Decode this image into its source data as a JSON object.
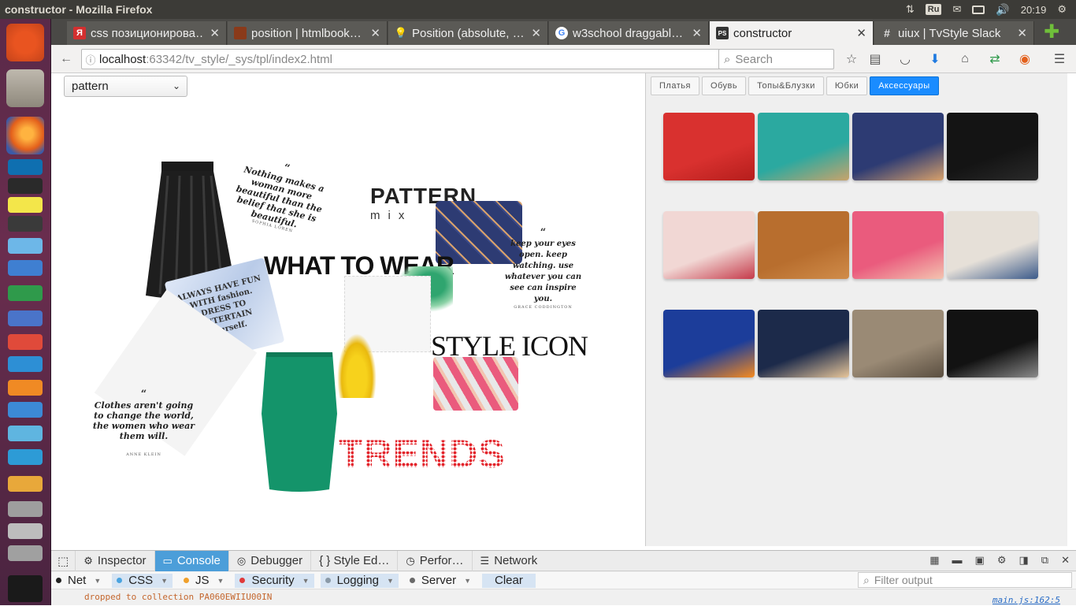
{
  "window_title": "constructor - Mozilla Firefox",
  "system": {
    "keyboard_layout": "Ru",
    "clock": "20:19"
  },
  "tabs": [
    {
      "label": "css позиционирова…",
      "favicon": "yandex-icon",
      "color": "#d32f2f",
      "glyph": "Я"
    },
    {
      "label": "position | htmlbook…",
      "favicon": "htmlbook-icon",
      "color": "#8a3a1a",
      "glyph": ""
    },
    {
      "label": "Position (absolute, …",
      "favicon": "lightbulb-icon",
      "color": "#f5c518",
      "glyph": "💡"
    },
    {
      "label": "w3school draggabl…",
      "favicon": "google-icon",
      "color": "#ffffff",
      "glyph": "G"
    },
    {
      "label": "constructor",
      "favicon": "pycharm-icon",
      "color": "#333333",
      "glyph": "PS"
    },
    {
      "label": "uiux | TvStyle Slack",
      "favicon": "slack-icon",
      "color": "#6b2d5b",
      "glyph": "#"
    }
  ],
  "navbar": {
    "url_host": "localhost",
    "url_rest": ":63342/tv_style/_sys/tpl/index2.html",
    "search_placeholder": "Search"
  },
  "page": {
    "select_value": "pattern",
    "collage": {
      "quote1_text": "Nothing makes a woman more beautiful than the belief that she is beautiful.",
      "quote1_author": "SOPHIA LOREN",
      "quote2_text": "keep your eyes open. keep watching. use whatever you can see can inspire you.",
      "quote2_author": "GRACE CODDINGTON",
      "quote3_text": "Clothes aren't going to change the world, the women who wear them will.",
      "quote3_author": "ANNE KLEIN",
      "quote4_text": "ALWAYS HAVE FUN WITH fashion. DRESS TO ENTERTAIN yourself.",
      "pattern_word": "PATTERN",
      "mix_word": "mix",
      "what_to_wear": "WHAT TO WEAR",
      "style_icon": "STYLE ICON",
      "trends": "TRENDS"
    }
  },
  "right_panel": {
    "category_tabs": [
      "Платья",
      "Обувь",
      "Топы&Блузки",
      "Юбки",
      "Аксессуары"
    ],
    "active_tab": "Аксессуары",
    "products": [
      {
        "name": "red-clutch",
        "colors": [
          "#d9312f",
          "#b51e1c"
        ]
      },
      {
        "name": "teal-tassel-clutch",
        "colors": [
          "#2ba9a0",
          "#c9a36b"
        ]
      },
      {
        "name": "navy-print-clutch",
        "colors": [
          "#2d3b73",
          "#d8a16b"
        ]
      },
      {
        "name": "black-clutch",
        "colors": [
          "#141414",
          "#2a2a2a"
        ]
      },
      {
        "name": "floral-clutch",
        "colors": [
          "#f1d7d4",
          "#c53a4a"
        ]
      },
      {
        "name": "studded-tan-clutch",
        "colors": [
          "#b86e2e",
          "#d08c4a"
        ]
      },
      {
        "name": "pink-triangle-clutch",
        "colors": [
          "#ea5b7d",
          "#f3c4b0"
        ]
      },
      {
        "name": "paisley-clutch",
        "colors": [
          "#e6e0d8",
          "#3b5a8a"
        ]
      },
      {
        "name": "orange-slice-clutch",
        "colors": [
          "#1c3d9a",
          "#f58a1f"
        ]
      },
      {
        "name": "tribal-clutch",
        "colors": [
          "#1c2a4a",
          "#e7c69a"
        ]
      },
      {
        "name": "snakeskin-clutch",
        "colors": [
          "#9a8a75",
          "#5a4e40"
        ]
      },
      {
        "name": "studded-black-clutch",
        "colors": [
          "#121212",
          "#8a8a8a"
        ]
      }
    ]
  },
  "devtools": {
    "tabs": [
      {
        "label": "Inspector",
        "icon": "wrench-icon",
        "glyph": "🔧"
      },
      {
        "label": "Console",
        "icon": "console-icon",
        "glyph": "▭"
      },
      {
        "label": "Debugger",
        "icon": "debugger-icon",
        "glyph": "⏸"
      },
      {
        "label": "{ } Style Ed…",
        "icon": "style-editor-icon",
        "glyph": ""
      },
      {
        "label": "Perfor…",
        "icon": "performance-icon",
        "glyph": "◷"
      },
      {
        "label": "Network",
        "icon": "network-icon",
        "glyph": "☰"
      }
    ],
    "active_tab": "Console",
    "filters": [
      {
        "label": "Net",
        "color": "#222222",
        "on": false
      },
      {
        "label": "CSS",
        "color": "#4aa3df",
        "on": true
      },
      {
        "label": "JS",
        "color": "#f0a02b",
        "on": false
      },
      {
        "label": "Security",
        "color": "#e03a3a",
        "on": true
      },
      {
        "label": "Logging",
        "color": "#8a9aa8",
        "on": true
      },
      {
        "label": "Server",
        "color": "#6a6a6a",
        "on": false
      }
    ],
    "clear_label": "Clear",
    "filter_placeholder": "Filter output",
    "console_message": "dropped to collection PA060EWIIU00IN",
    "console_source": "main.js:162:5"
  }
}
